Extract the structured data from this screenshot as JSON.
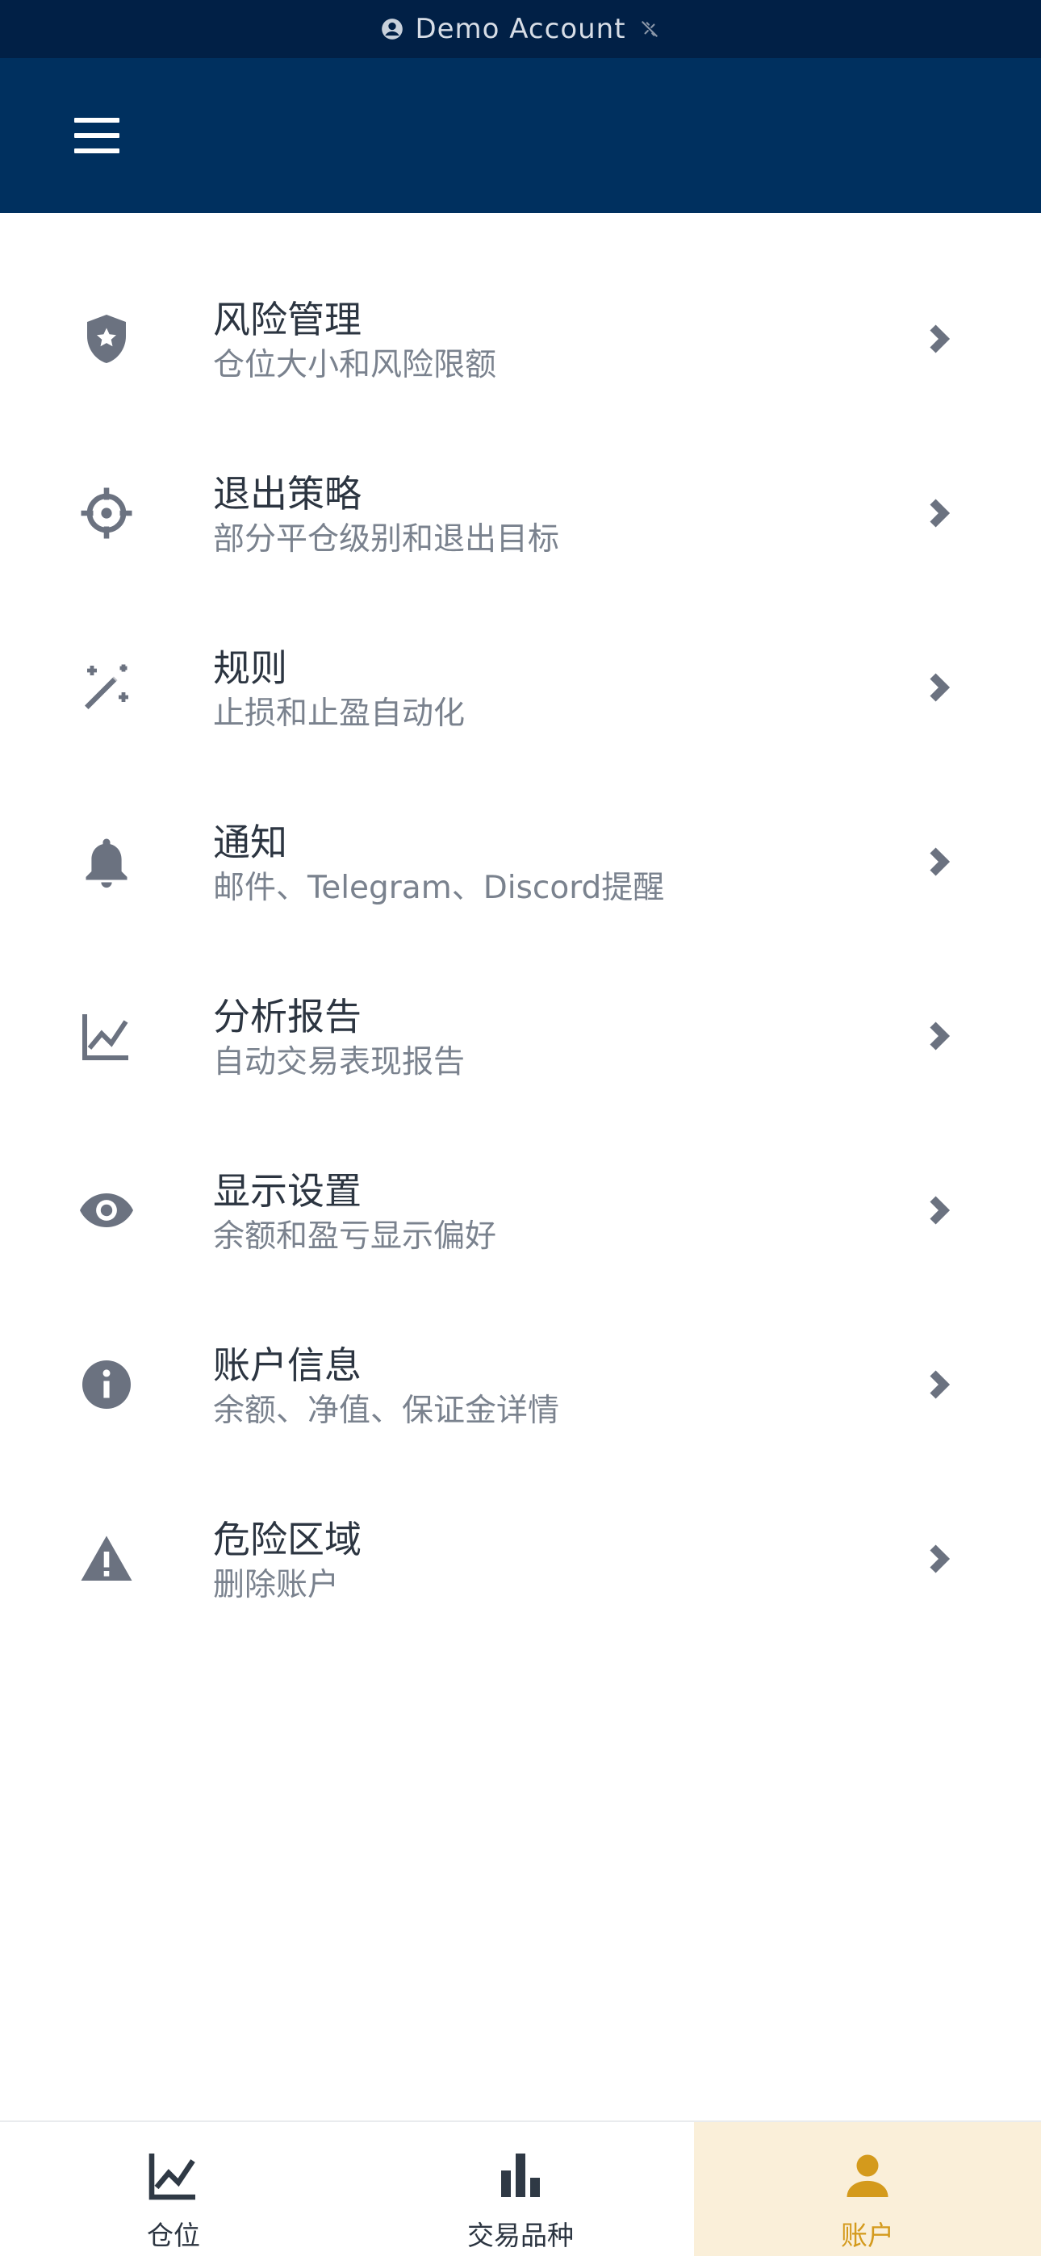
{
  "status_bar": {
    "account_label": "Demo Account"
  },
  "menu": [
    {
      "title": "风险管理",
      "subtitle": "仓位大小和风险限额",
      "icon": "shield-star-icon"
    },
    {
      "title": "退出策略",
      "subtitle": "部分平仓级别和退出目标",
      "icon": "crosshair-icon"
    },
    {
      "title": "规则",
      "subtitle": "止损和止盈自动化",
      "icon": "magic-wand-icon"
    },
    {
      "title": "通知",
      "subtitle": "邮件、Telegram、Discord提醒",
      "icon": "bell-icon"
    },
    {
      "title": "分析报告",
      "subtitle": "自动交易表现报告",
      "icon": "line-chart-icon"
    },
    {
      "title": "显示设置",
      "subtitle": "余额和盈亏显示偏好",
      "icon": "eye-icon"
    },
    {
      "title": "账户信息",
      "subtitle": "余额、净值、保证金详情",
      "icon": "info-icon"
    },
    {
      "title": "危险区域",
      "subtitle": "删除账户",
      "icon": "warning-icon"
    }
  ],
  "tabs": [
    {
      "label": "仓位",
      "icon": "line-chart-icon"
    },
    {
      "label": "交易品种",
      "icon": "bar-chart-icon"
    },
    {
      "label": "账户",
      "icon": "person-icon",
      "active": true
    }
  ],
  "colors": {
    "header_bg": "#00305f",
    "status_bg": "#012046",
    "icon_gray": "#6b7280",
    "active_tab_bg": "#faefd9",
    "active_tab_accent": "#d49a1c"
  }
}
